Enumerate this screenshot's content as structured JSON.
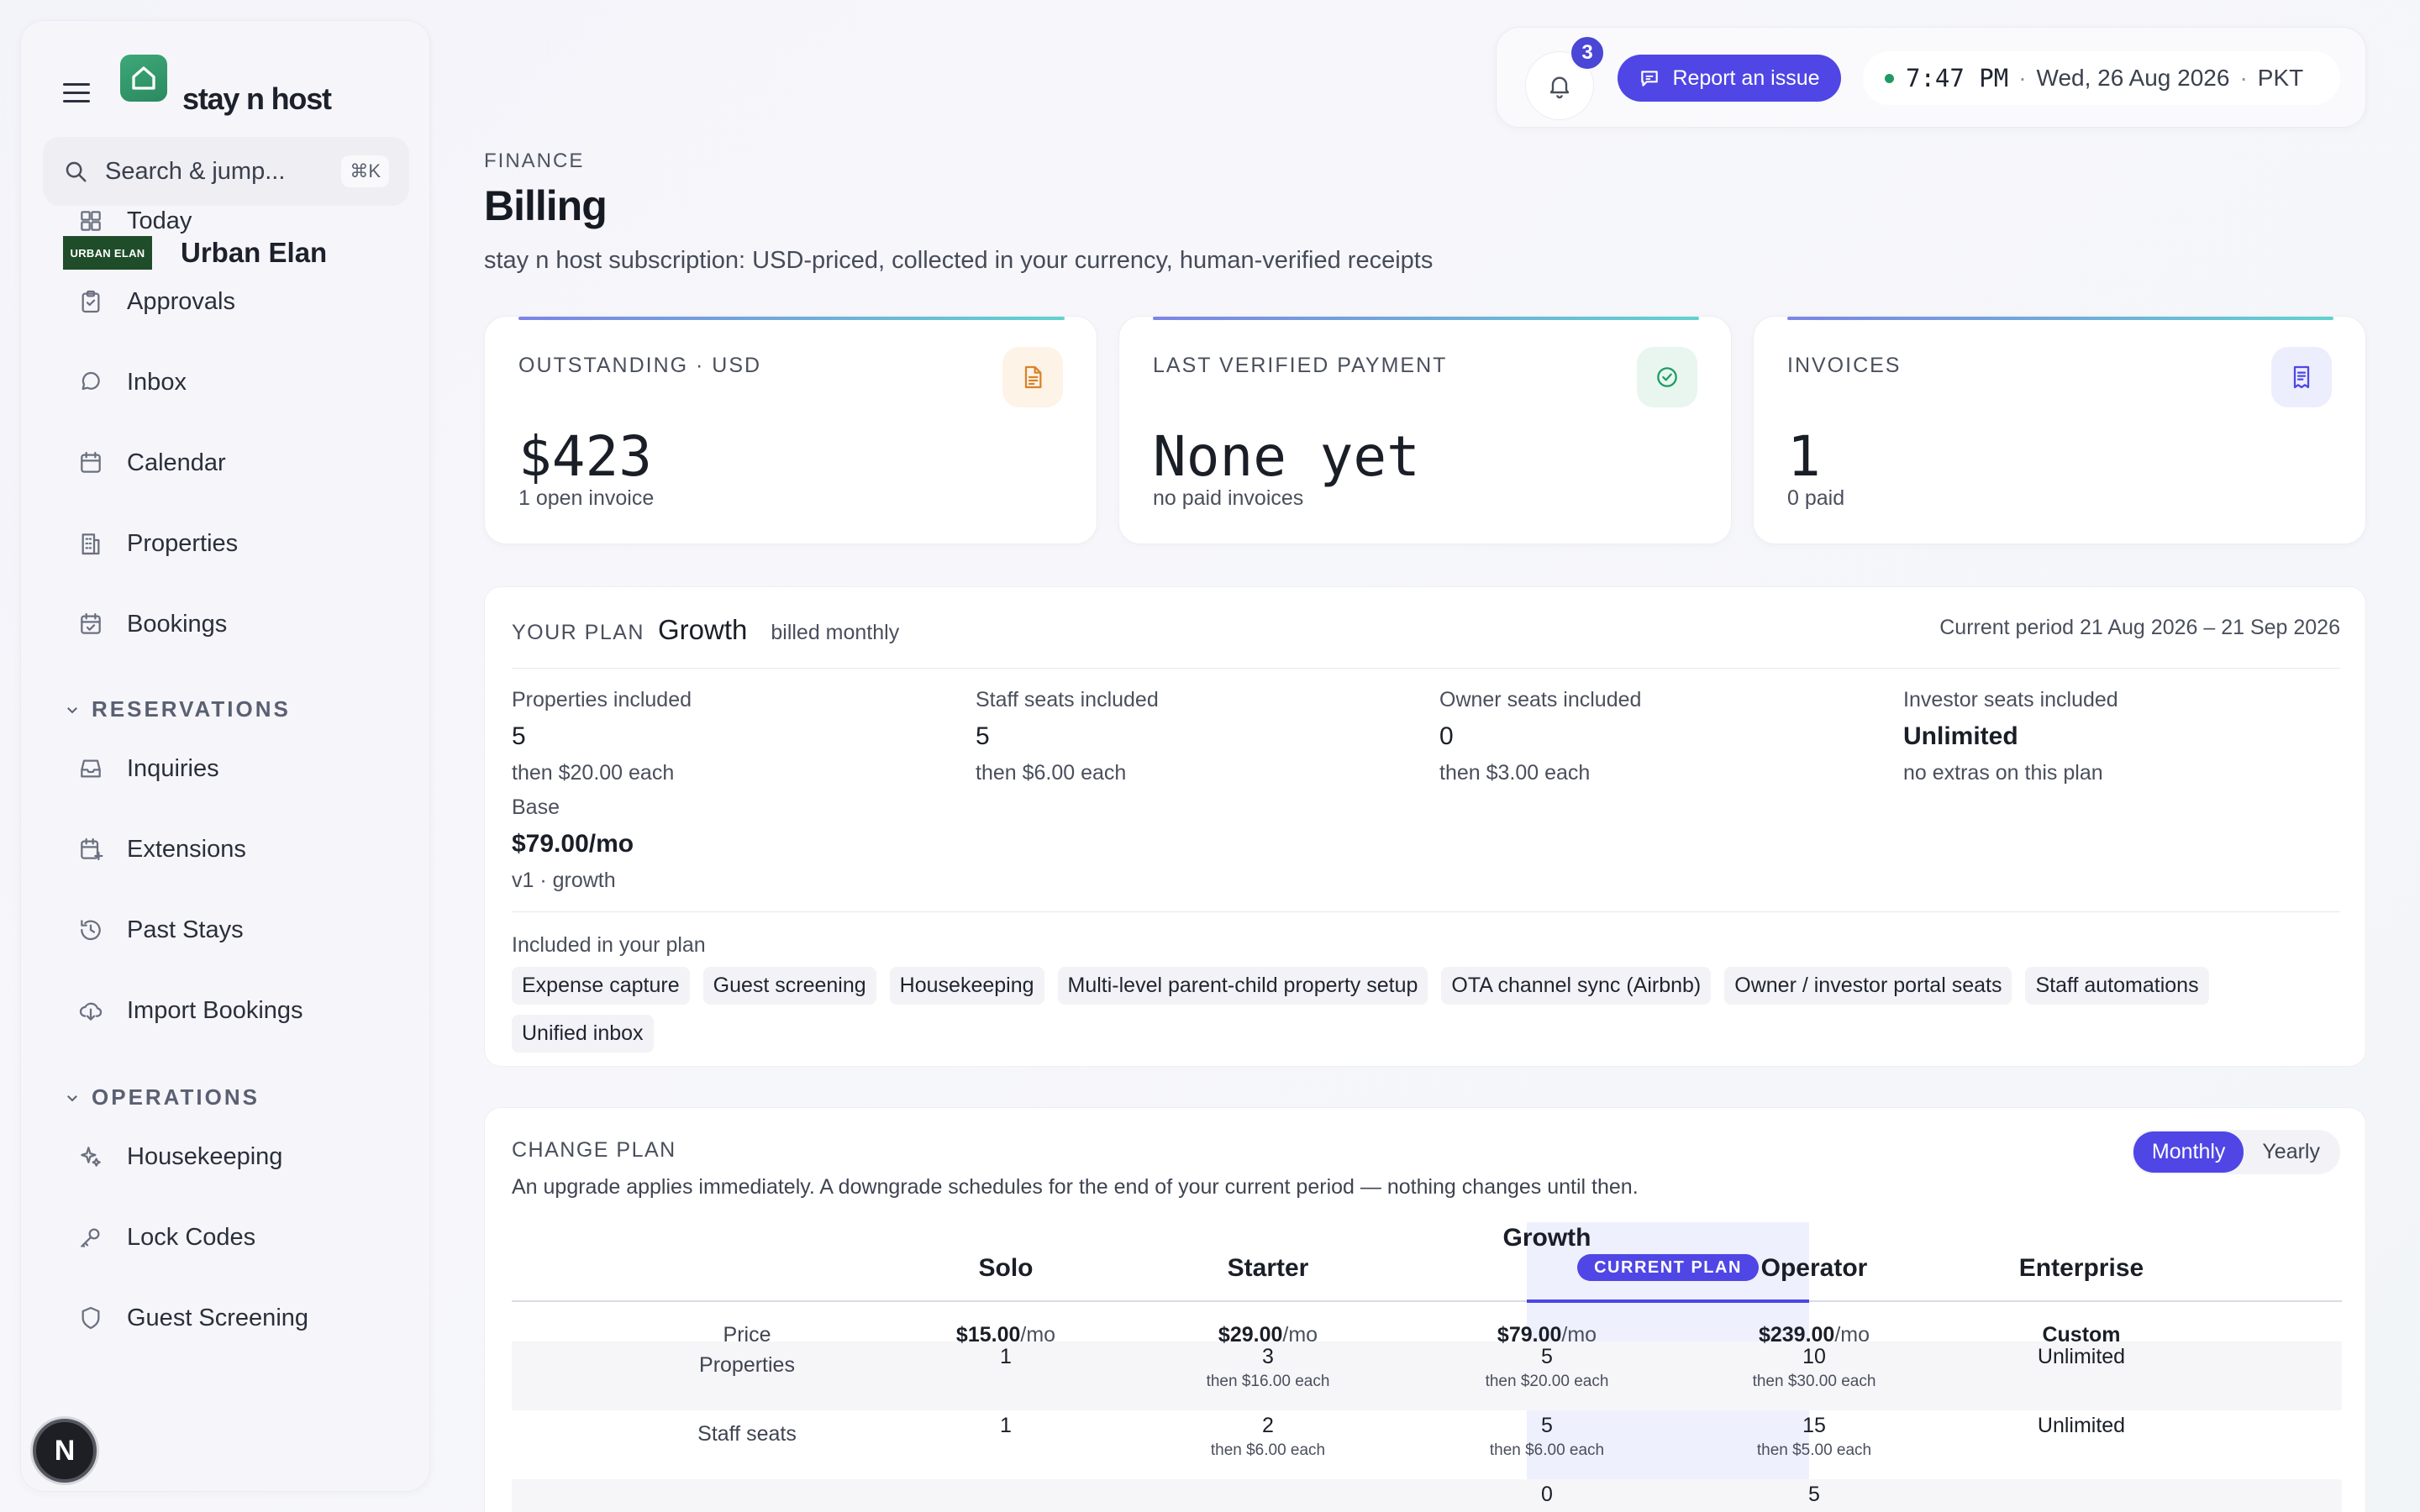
{
  "app": {
    "brand": "stay n host",
    "org_logo_text": "URBAN ELAN",
    "org_name": "Urban Elan"
  },
  "search": {
    "placeholder": "Search & jump...",
    "shortcut": "⌘K"
  },
  "sidebar": {
    "items": [
      {
        "label": "Today",
        "icon": "grid-icon"
      },
      {
        "label": "Approvals",
        "icon": "clipboard-check-icon"
      },
      {
        "label": "Inbox",
        "icon": "chat-bubble-icon"
      },
      {
        "label": "Calendar",
        "icon": "calendar-icon"
      },
      {
        "label": "Properties",
        "icon": "building-icon"
      },
      {
        "label": "Bookings",
        "icon": "calendar-check-icon"
      }
    ],
    "sections": [
      {
        "title": "RESERVATIONS",
        "items": [
          {
            "label": "Inquiries",
            "icon": "inbox-tray-icon"
          },
          {
            "label": "Extensions",
            "icon": "calendar-plus-icon"
          },
          {
            "label": "Past Stays",
            "icon": "history-icon"
          },
          {
            "label": "Import Bookings",
            "icon": "cloud-download-icon"
          }
        ]
      },
      {
        "title": "OPERATIONS",
        "items": [
          {
            "label": "Housekeeping",
            "icon": "sparkles-icon"
          },
          {
            "label": "Lock Codes",
            "icon": "key-icon"
          },
          {
            "label": "Guest Screening",
            "icon": "shield-icon"
          }
        ]
      }
    ],
    "user_initial": "N"
  },
  "topbar": {
    "notifications": "3",
    "report_label": "Report an issue",
    "time": "7:47 PM",
    "date": "Wed, 26 Aug 2026",
    "timezone": "PKT",
    "separator": "·"
  },
  "header": {
    "eyebrow": "FINANCE",
    "title": "Billing",
    "subtitle": "stay n host subscription: USD-priced, collected in your currency, human-verified receipts"
  },
  "cards": [
    {
      "label": "OUTSTANDING · USD",
      "value": "$423",
      "sub": "1 open invoice",
      "icon": "document-icon",
      "accent": "#d9822b"
    },
    {
      "label": "LAST VERIFIED PAYMENT",
      "value": "None yet",
      "sub": "no paid invoices",
      "icon": "check-badge-icon",
      "accent": "#1e9b62"
    },
    {
      "label": "INVOICES",
      "value": "1",
      "sub": "0 paid",
      "icon": "receipt-icon",
      "accent": "#4f46e5"
    }
  ],
  "plan": {
    "label": "YOUR PLAN",
    "name": "Growth",
    "billing": "billed monthly",
    "period": "Current period 21 Aug 2026 – 21 Sep 2026",
    "metrics": [
      {
        "label": "Properties included",
        "value": "5",
        "sub": "then $20.00 each"
      },
      {
        "label": "Staff seats included",
        "value": "5",
        "sub": "then $6.00 each"
      },
      {
        "label": "Owner seats included",
        "value": "0",
        "sub": "then $3.00 each"
      },
      {
        "label": "Investor seats included",
        "value": "Unlimited",
        "sub": "no extras on this plan"
      },
      {
        "label": "Base",
        "value": "$79.00/mo",
        "sub": "v1 · growth"
      }
    ],
    "included_label": "Included in your plan",
    "features": [
      "Expense capture",
      "Guest screening",
      "Housekeeping",
      "Multi-level parent-child property setup",
      "OTA channel sync (Airbnb)",
      "Owner / investor portal seats",
      "Staff automations",
      "Unified inbox"
    ]
  },
  "change_plan": {
    "label": "CHANGE PLAN",
    "description": "An upgrade applies immediately. A downgrade schedules for the end of your current period — nothing changes until then.",
    "toggle": [
      "Monthly",
      "Yearly"
    ],
    "current_tag": "CURRENT PLAN",
    "columns": [
      "Solo",
      "Starter",
      "Growth",
      "Operator",
      "Enterprise"
    ],
    "rows": [
      {
        "label": "Price",
        "cells": [
          {
            "v": "$15.00",
            "u": "/mo"
          },
          {
            "v": "$29.00",
            "u": "/mo"
          },
          {
            "v": "$79.00",
            "u": "/mo"
          },
          {
            "v": "$239.00",
            "u": "/mo"
          },
          {
            "v": "Custom",
            "u": ""
          }
        ]
      },
      {
        "label": "Properties",
        "cells": [
          {
            "v": "1",
            "s": ""
          },
          {
            "v": "3",
            "s": "then $16.00 each"
          },
          {
            "v": "5",
            "s": "then $20.00 each"
          },
          {
            "v": "10",
            "s": "then $30.00 each"
          },
          {
            "v": "Unlimited",
            "s": ""
          }
        ]
      },
      {
        "label": "Staff seats",
        "cells": [
          {
            "v": "1",
            "s": ""
          },
          {
            "v": "2",
            "s": "then $6.00 each"
          },
          {
            "v": "5",
            "s": "then $6.00 each"
          },
          {
            "v": "15",
            "s": "then $5.00 each"
          },
          {
            "v": "Unlimited",
            "s": ""
          }
        ]
      },
      {
        "label": "",
        "cells": [
          {
            "v": "",
            "s": ""
          },
          {
            "v": "",
            "s": ""
          },
          {
            "v": "0",
            "s": ""
          },
          {
            "v": "5",
            "s": ""
          },
          {
            "v": "",
            "s": ""
          }
        ]
      }
    ]
  }
}
